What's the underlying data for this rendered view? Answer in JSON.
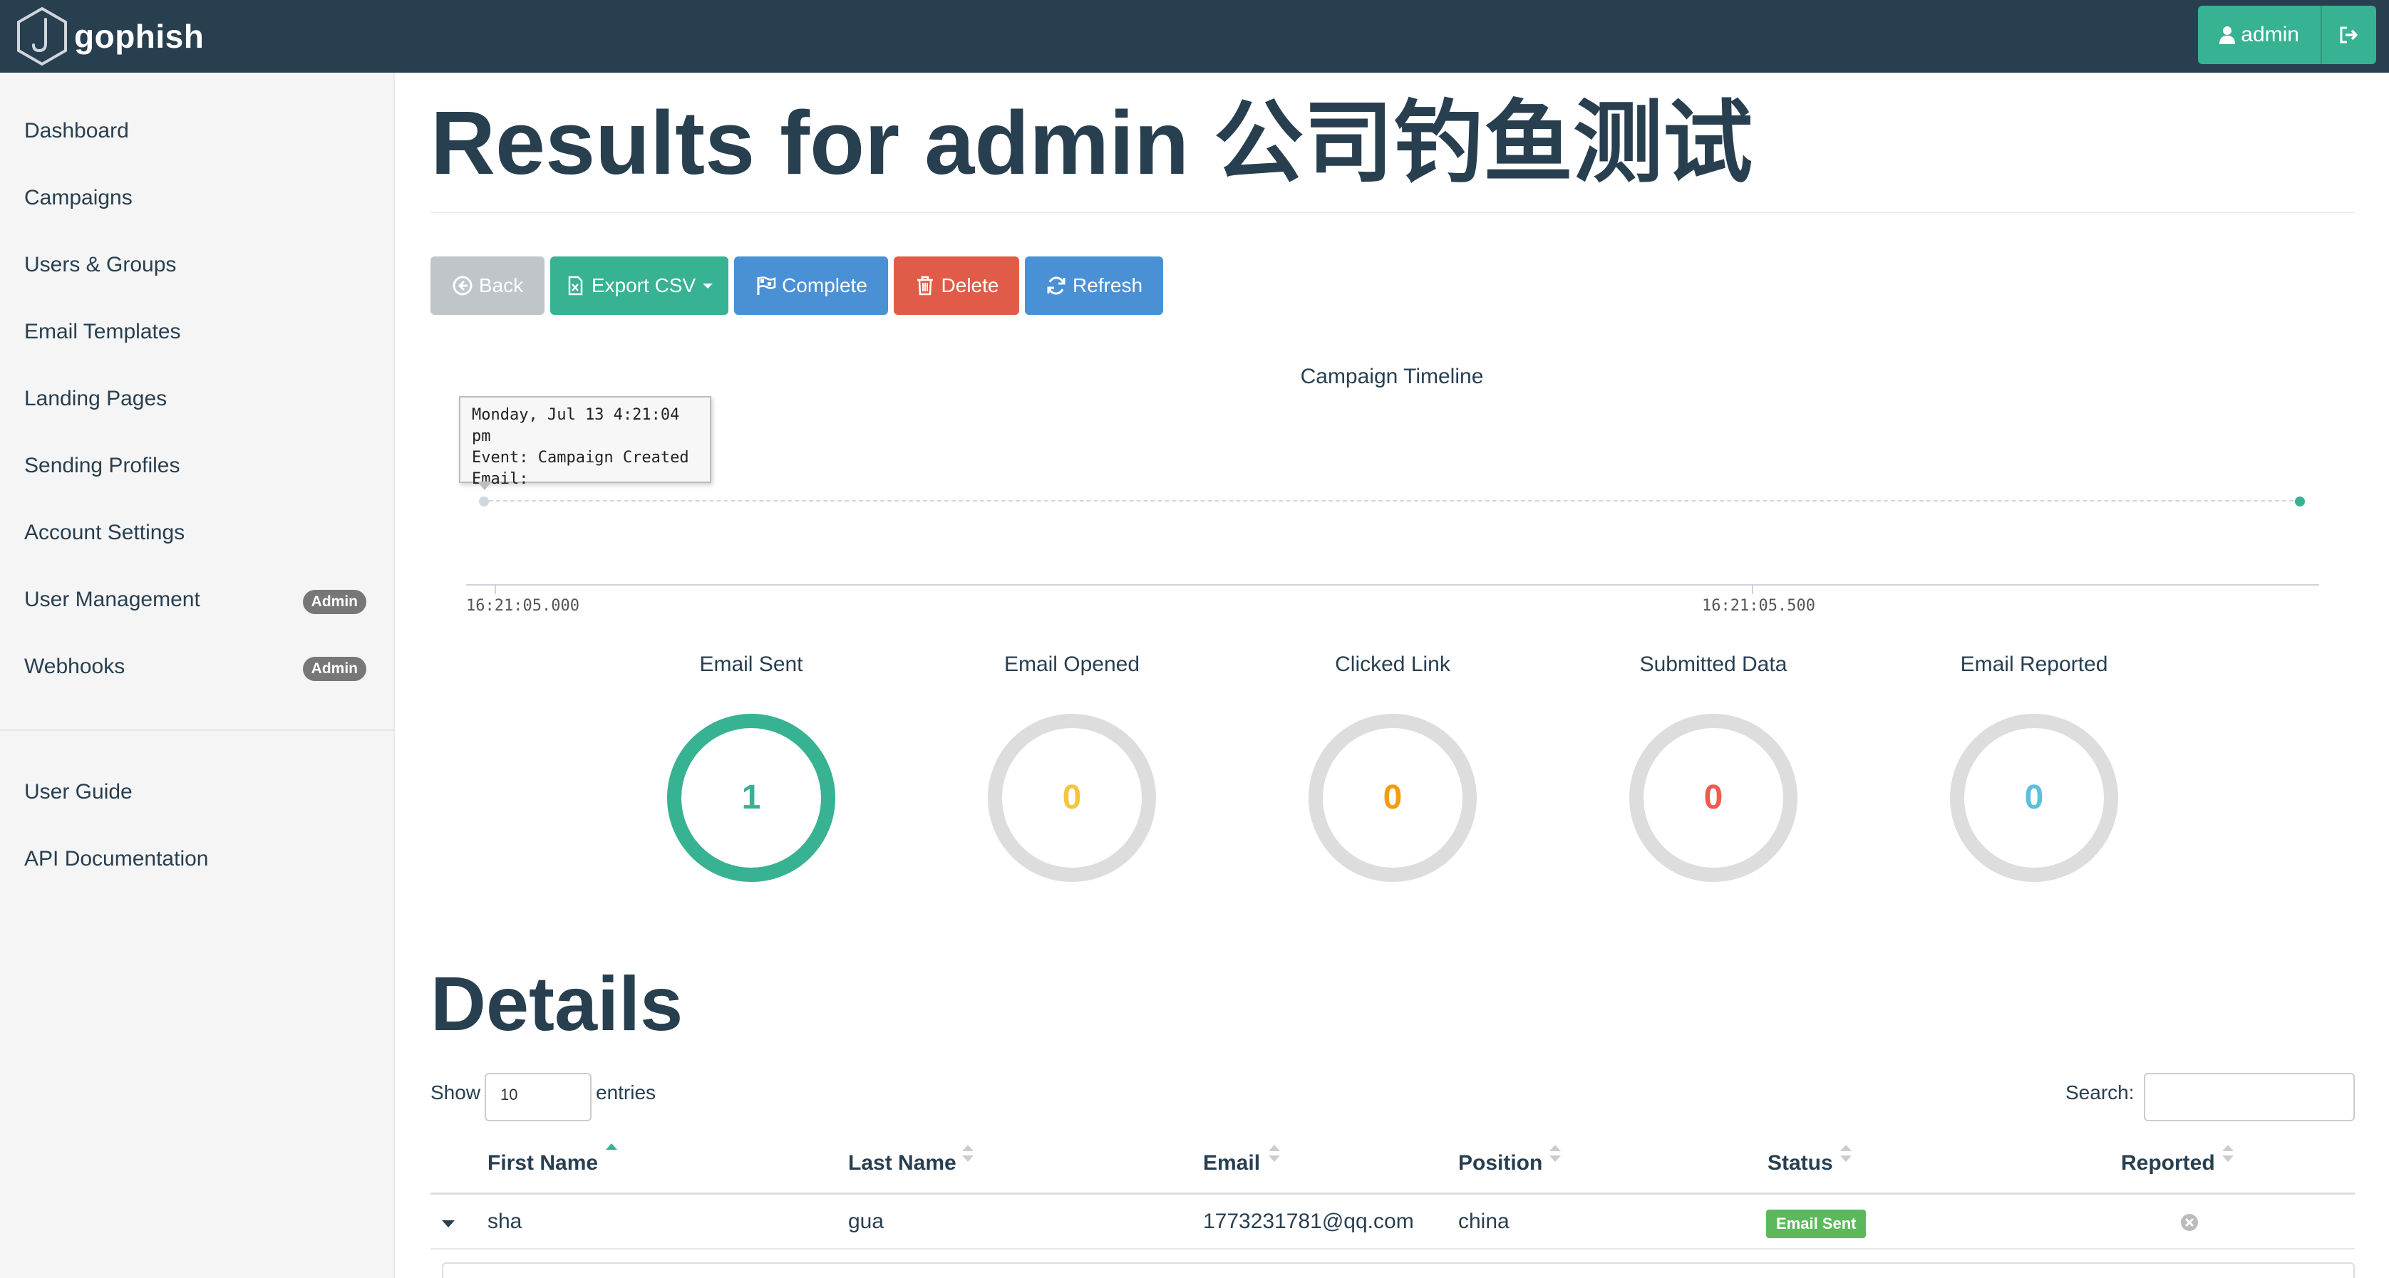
{
  "navbar": {
    "brand": "gophish",
    "user_label": "admin",
    "accent": "#37b292",
    "background": "#283f50"
  },
  "sidebar": {
    "items": [
      {
        "label": "Dashboard"
      },
      {
        "label": "Campaigns"
      },
      {
        "label": "Users & Groups"
      },
      {
        "label": "Email Templates"
      },
      {
        "label": "Landing Pages"
      },
      {
        "label": "Sending Profiles"
      },
      {
        "label": "Account Settings"
      },
      {
        "label": "User Management",
        "badge": "Admin"
      },
      {
        "label": "Webhooks",
        "badge": "Admin"
      }
    ],
    "secondary": [
      {
        "label": "User Guide"
      },
      {
        "label": "API Documentation"
      }
    ]
  },
  "page": {
    "title": "Results for admin 公司钓鱼测试"
  },
  "toolbar": {
    "back": "Back",
    "export": "Export CSV",
    "complete": "Complete",
    "delete": "Delete",
    "refresh": "Refresh"
  },
  "timeline": {
    "title": "Campaign Timeline",
    "tooltip": {
      "line1": "Monday, Jul 13 4:21:04 pm",
      "line2": "Event: Campaign Created",
      "line3": "Email:"
    },
    "tick_labels": [
      "16:21:05.000",
      "16:21:05.500"
    ]
  },
  "stats": [
    {
      "label": "Email Sent",
      "value": "1",
      "fraction": 1,
      "color": "#37b292"
    },
    {
      "label": "Email Opened",
      "value": "0",
      "fraction": 0,
      "color": "#f4c542"
    },
    {
      "label": "Clicked Link",
      "value": "0",
      "fraction": 0,
      "color": "#f39c12"
    },
    {
      "label": "Submitted Data",
      "value": "0",
      "fraction": 0,
      "color": "#f05b4f"
    },
    {
      "label": "Email Reported",
      "value": "0",
      "fraction": 0,
      "color": "#5bc0de"
    }
  ],
  "details": {
    "title": "Details",
    "show_label": "Show",
    "entries_value": "10",
    "entries_label": "entries",
    "search_label": "Search:",
    "columns": [
      "First Name",
      "Last Name",
      "Email",
      "Position",
      "Status",
      "Reported"
    ],
    "rows": [
      {
        "first_name": "sha",
        "last_name": "gua",
        "email": "1773231781@qq.com",
        "position": "china",
        "status": "Email Sent"
      }
    ]
  }
}
